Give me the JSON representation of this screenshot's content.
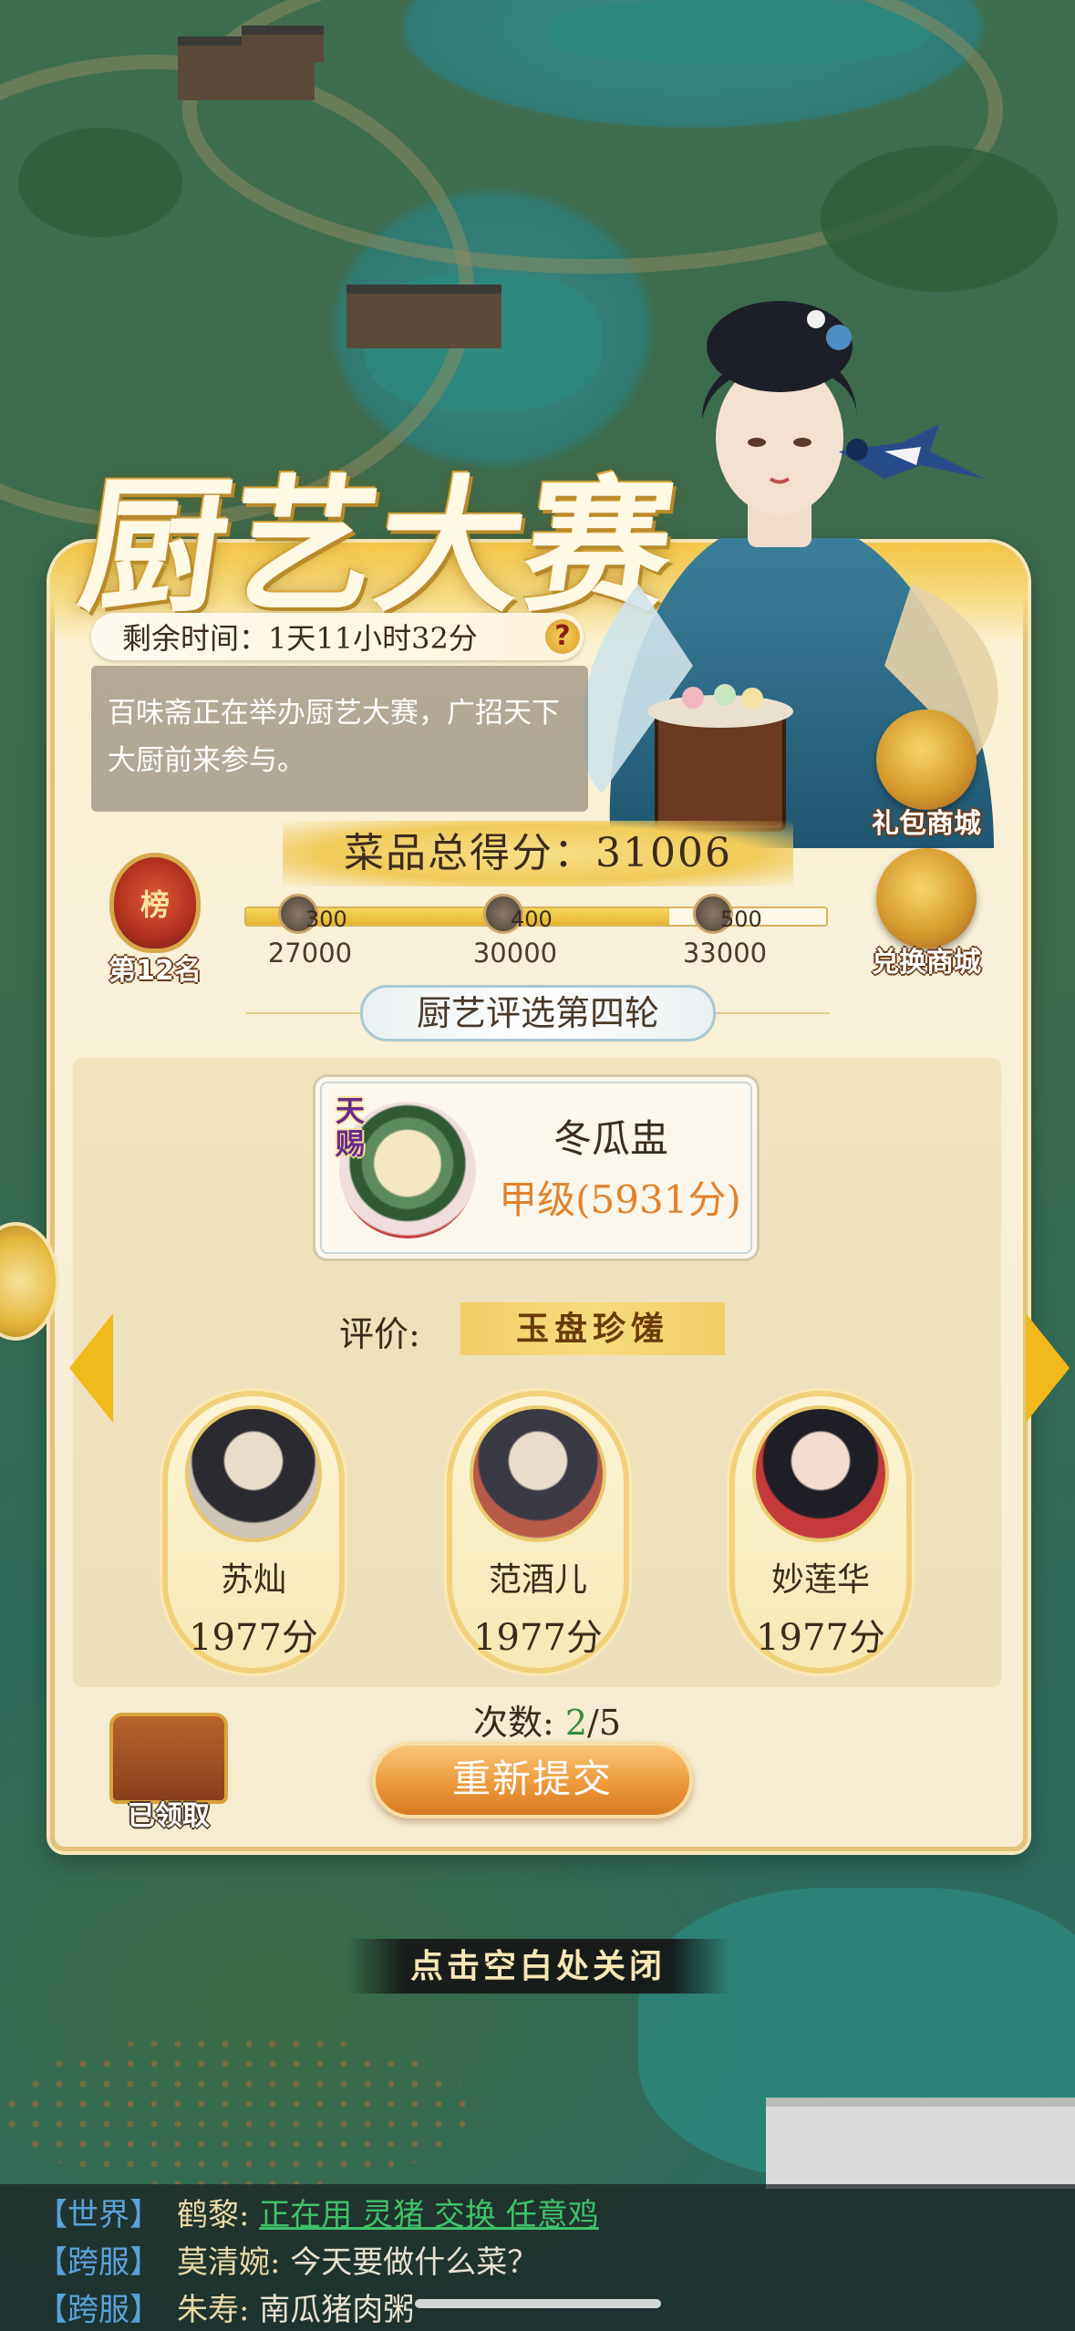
{
  "event": {
    "title": "厨艺大赛",
    "timer": "剩余时间：1天11小时32分",
    "description": "百味斋正在举办厨艺大赛，广招天下大厨前来参与。"
  },
  "shops": {
    "gift": "礼包商城",
    "exchange": "兑换商城"
  },
  "score": {
    "label": "菜品总得分：31006",
    "value": 31006
  },
  "rank": {
    "badge": "榜",
    "label": "第12名"
  },
  "progress": {
    "fraction": 0.73,
    "milestones": [
      {
        "reward": "300",
        "threshold": "27000"
      },
      {
        "reward": "400",
        "threshold": "30000"
      },
      {
        "reward": "500",
        "threshold": "33000"
      }
    ]
  },
  "round": "厨艺评选第四轮",
  "dish": {
    "tag": "天赐",
    "name": "冬瓜盅",
    "grade": "甲级(5931分)"
  },
  "rating": {
    "label": "评价:",
    "value": "玉盘珍馐"
  },
  "judges": [
    {
      "name": "苏灿",
      "points": "1977分"
    },
    {
      "name": "范酒儿",
      "points": "1977分"
    },
    {
      "name": "妙莲华",
      "points": "1977分"
    }
  ],
  "attempts": {
    "label": "次数:",
    "current": "2",
    "total": "/5"
  },
  "resubmit_label": "重新提交",
  "chest_label": "已领取",
  "close_hint": "点击空白处关闭",
  "chat": [
    {
      "channel": "【世界】",
      "sender": "鹤黎:",
      "message": "正在用 灵猪 交换 任意鸡",
      "link": true
    },
    {
      "channel": "【跨服】",
      "sender": "莫清婉:",
      "message": "今天要做什么菜？",
      "link": false
    },
    {
      "channel": "【跨服】",
      "sender": "朱寿:",
      "message": "南瓜猪肉粥",
      "link": false
    }
  ],
  "colors": {
    "accent_gold": "#f2c546",
    "grade_orange": "#e2822d",
    "count_green": "#3a8a3a",
    "chat_channel": "#5aa2d8",
    "chat_link": "#3ec26a"
  }
}
